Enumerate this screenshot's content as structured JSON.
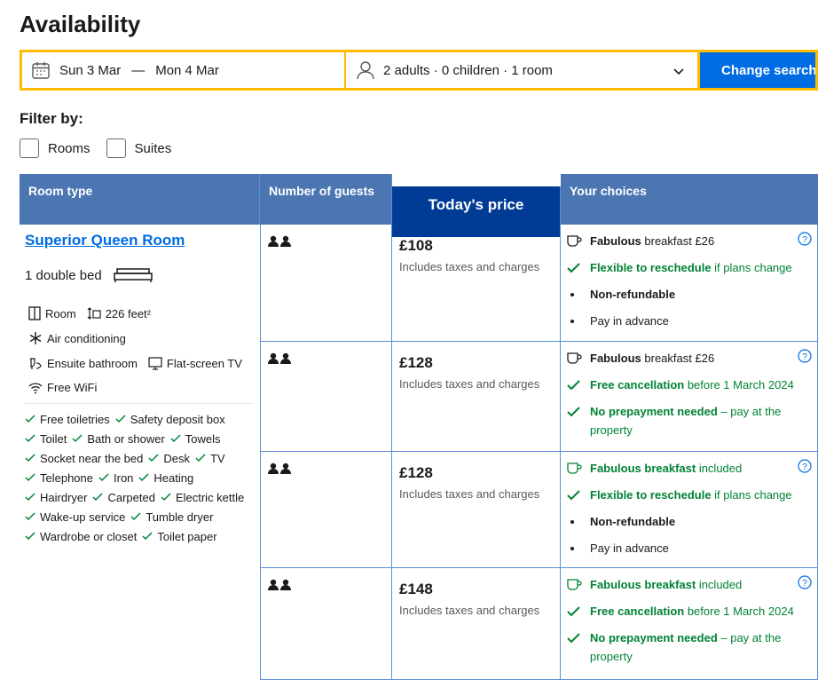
{
  "page": {
    "title": "Availability"
  },
  "search": {
    "check_in": "Sun 3 Mar",
    "separator": "—",
    "check_out": "Mon 4 Mar",
    "guests": "2 adults · 0 children · 1 room",
    "button": "Change search"
  },
  "filters": {
    "label": "Filter by:",
    "options": [
      "Rooms",
      "Suites"
    ]
  },
  "table": {
    "headers": [
      "Room type",
      "Number of guests",
      "Today's price",
      "Your choices"
    ],
    "room": {
      "name": "Superior Queen Room",
      "bed": "1 double bed",
      "facilities": {
        "room": "Room",
        "size": "226 feet²",
        "aircon": "Air conditioning",
        "bathroom": "Ensuite bathroom",
        "tv": "Flat-screen TV",
        "wifi": "Free WiFi"
      },
      "amenities": [
        [
          "Free toiletries",
          "Safety deposit box"
        ],
        [
          "Toilet",
          "Bath or shower",
          "Towels"
        ],
        [
          "Socket near the bed",
          "Desk",
          "TV"
        ],
        [
          "Telephone",
          "Iron",
          "Heating"
        ],
        [
          "Hairdryer",
          "Carpeted",
          "Electric kettle"
        ],
        [
          "Wake-up service",
          "Tumble dryer"
        ],
        [
          "Wardrobe or closet",
          "Toilet paper"
        ]
      ]
    },
    "rows": [
      {
        "price": "£108",
        "price_note": "Includes taxes and charges",
        "breakfast_bold": "Fabulous",
        "breakfast_rest": " breakfast £26",
        "c2_bold": "Flexible to reschedule",
        "c2_rest": " if plans change",
        "c3": "Non-refundable",
        "c4": "Pay in advance"
      },
      {
        "price": "£128",
        "price_note": "Includes taxes and charges",
        "breakfast_bold": "Fabulous",
        "breakfast_rest": " breakfast £26",
        "c2_bold": "Free cancellation",
        "c2_rest": " before 1 March 2024",
        "c3_bold": "No prepayment needed",
        "c3_rest": " – pay at the",
        "c3_line2": "property"
      },
      {
        "price": "£128",
        "price_note": "Includes taxes and charges",
        "breakfast_bold": "Fabulous breakfast",
        "breakfast_rest": " included",
        "c2_bold": "Flexible to reschedule",
        "c2_rest": " if plans change",
        "c3": "Non-refundable",
        "c4": "Pay in advance"
      },
      {
        "price": "£148",
        "price_note": "Includes taxes and charges",
        "breakfast_bold": "Fabulous breakfast",
        "breakfast_rest": " included",
        "c2_bold": "Free cancellation",
        "c2_rest": " before 1 March 2024",
        "c3_bold": "No prepayment needed",
        "c3_rest": " – pay at the",
        "c3_line2": "property"
      }
    ]
  },
  "colors": {
    "accent_yellow": "#febb02",
    "button_blue": "#006ce4",
    "header_blue": "#4c76b2",
    "price_header_blue": "#003b95",
    "green": "#008234"
  }
}
